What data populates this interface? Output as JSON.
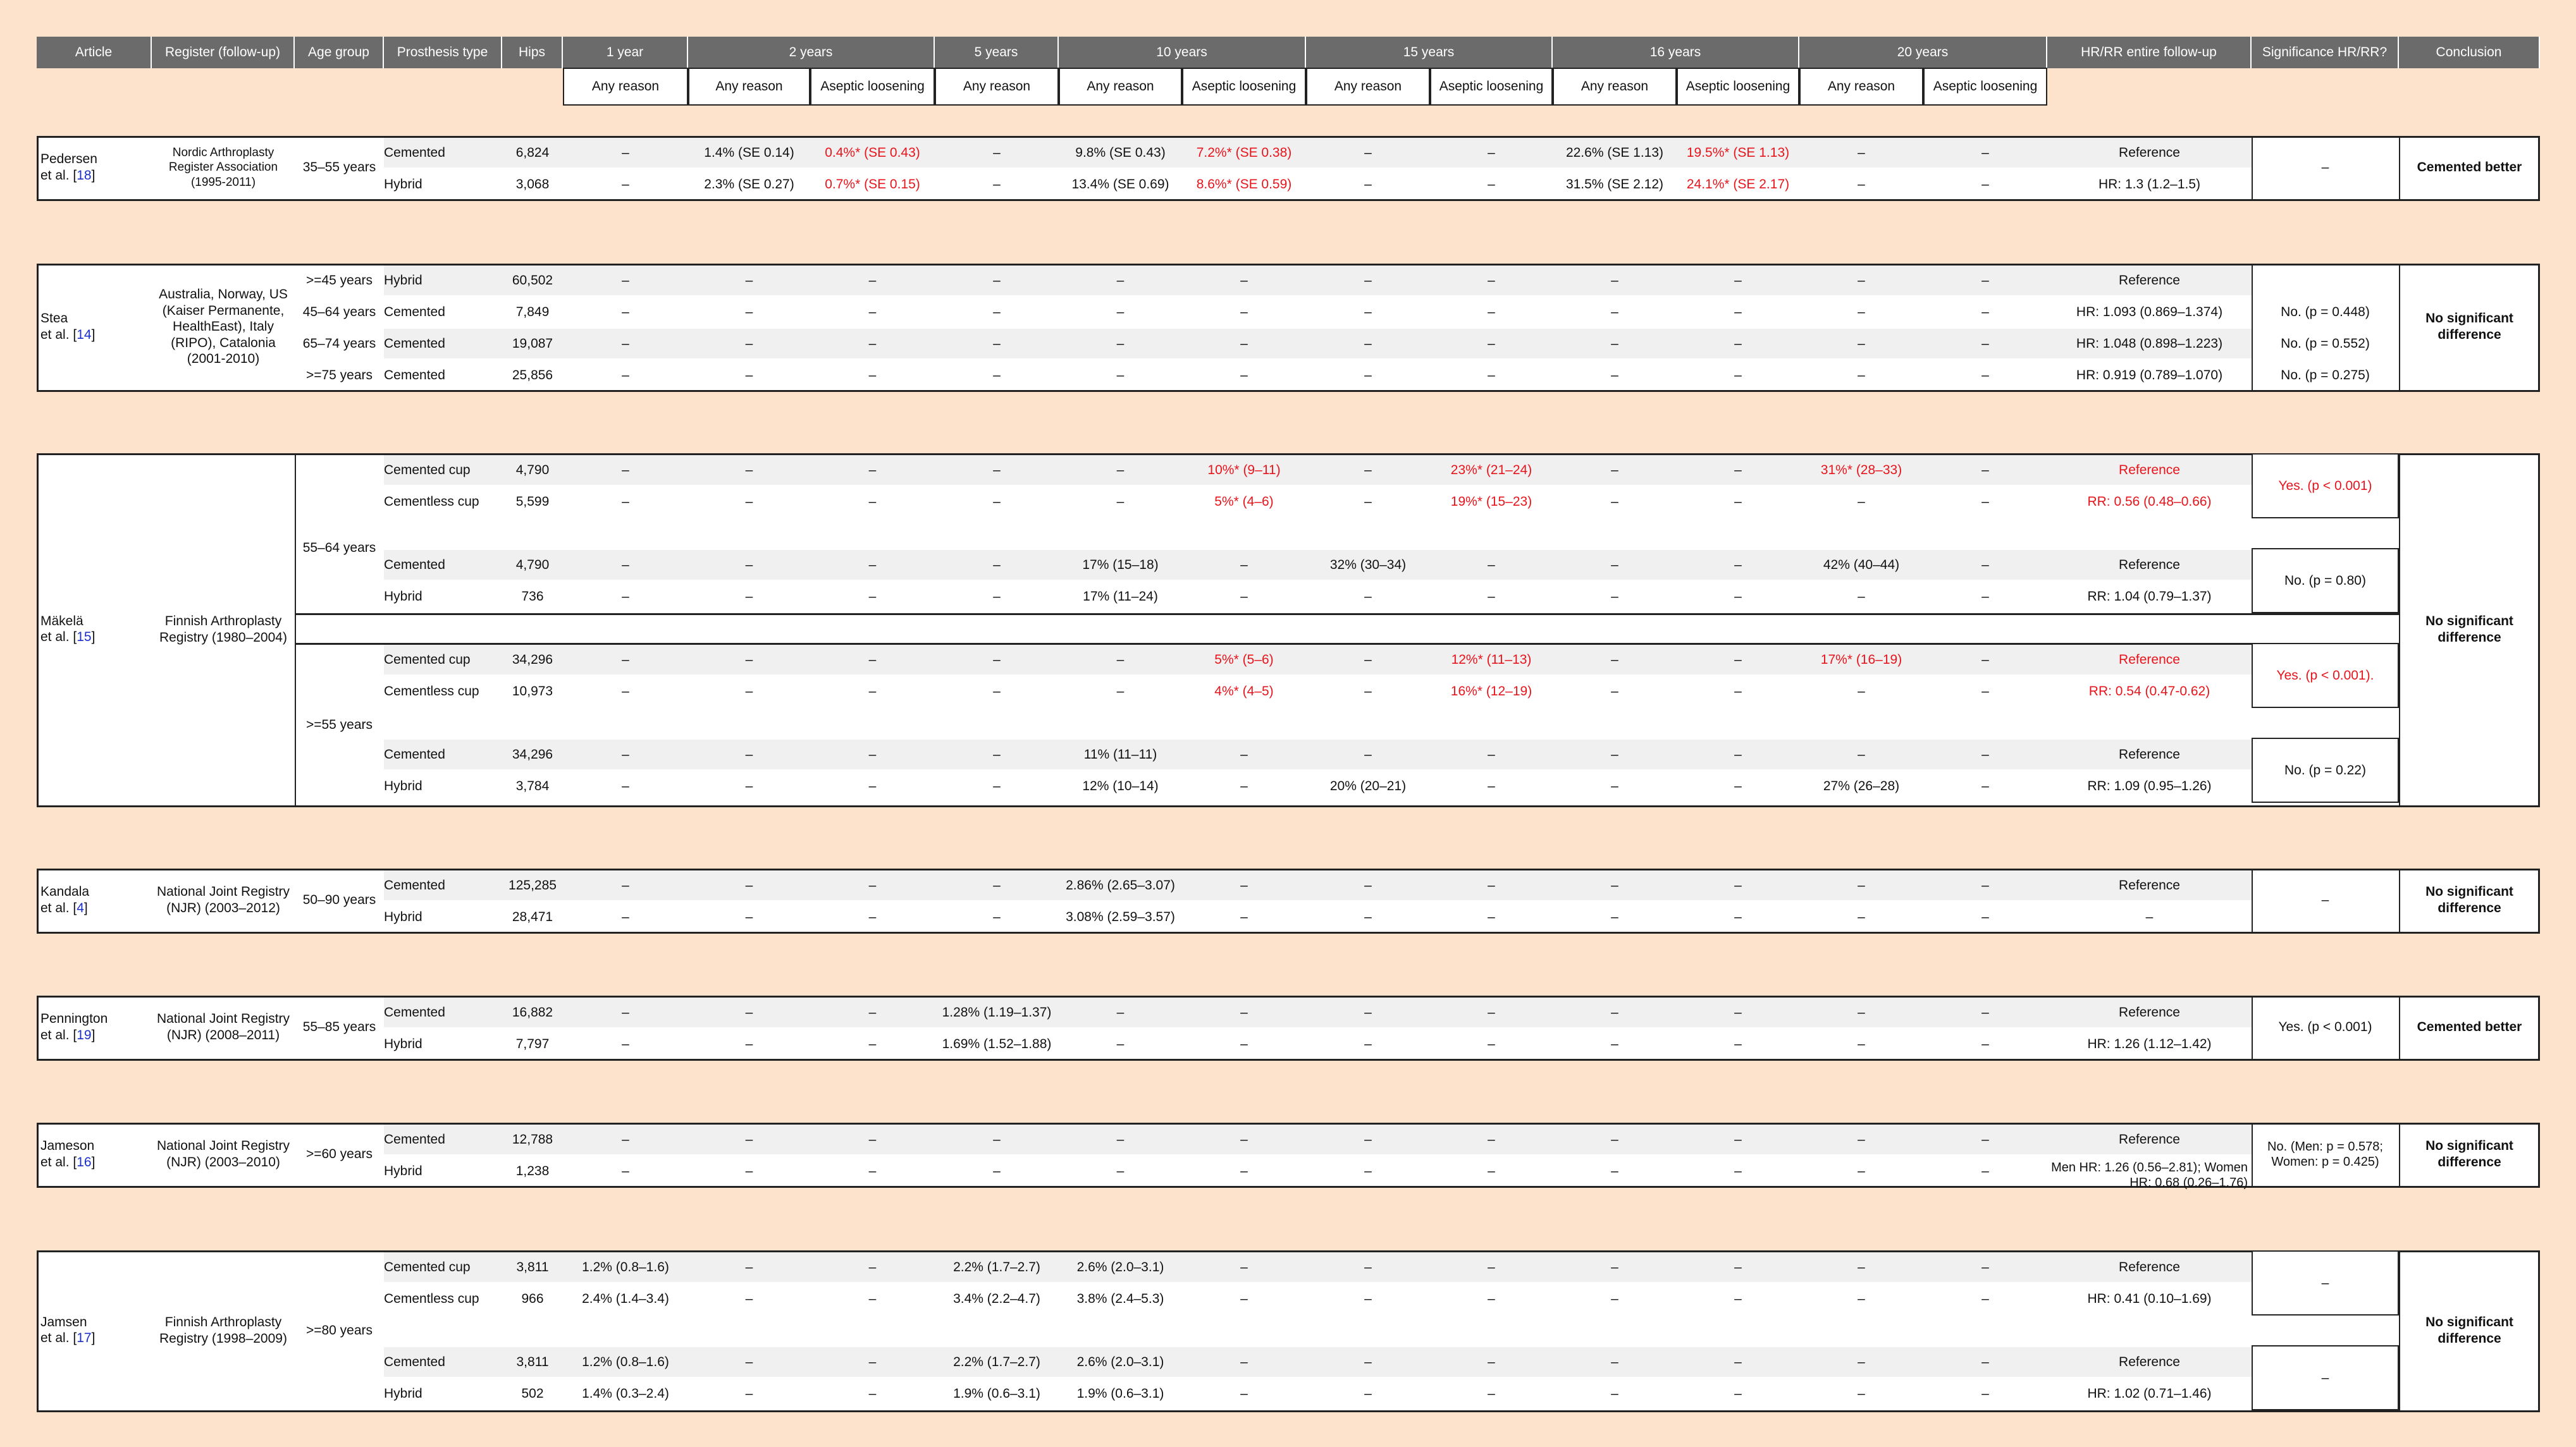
{
  "headers": [
    "Article",
    "Register (follow-up)",
    "Age group",
    "Prosthesis type",
    "Hips",
    "1 year",
    "2 years",
    "5 years",
    "10 years",
    "15 years",
    "16 years",
    "20 years",
    "HR/RR entire follow-up",
    "Significance HR/RR?",
    "Conclusion"
  ],
  "sub_headers": {
    "any": "Any reason",
    "aseptic": "Aseptic loosening"
  },
  "dash": "–",
  "pedersen": {
    "article_a": "Pedersen",
    "article_b": "et al. [",
    "ref": "18",
    "article_c": "]",
    "register": "Nordic Arthroplasty Register Association (1995-2011)",
    "age": "35–55 years",
    "rows": [
      {
        "type": "Cemented",
        "hips": "6,824",
        "y2a": "1.4% (SE 0.14)",
        "y2b": "0.4%* (SE 0.43)",
        "y10a": "9.8% (SE 0.43)",
        "y10b": "7.2%* (SE 0.38)",
        "y16a": "22.6% (SE 1.13)",
        "y16b": "19.5%* (SE 1.13)",
        "hr": "Reference"
      },
      {
        "type": "Hybrid",
        "hips": "3,068",
        "y2a": "2.3% (SE 0.27)",
        "y2b": "0.7%* (SE 0.15)",
        "y10a": "13.4% (SE 0.69)",
        "y10b": "8.6%* (SE 0.59)",
        "y16a": "31.5% (SE 2.12)",
        "y16b": "24.1%* (SE 2.17)",
        "hr": "HR: 1.3 (1.2–1.5)"
      }
    ],
    "sig": "–",
    "conclusion": "Cemented better"
  },
  "stea": {
    "article_a": "Stea",
    "article_b": "et al. [",
    "ref": "14",
    "article_c": "]",
    "register": "Australia, Norway, US (Kaiser Permanente, HealthEast), Italy (RIPO), Catalonia (2001-2010)",
    "rows": [
      {
        "age": ">=45 years",
        "type": "Hybrid",
        "hips": "60,502",
        "hr": "Reference",
        "sig": ""
      },
      {
        "age": "45–64 years",
        "type": "Cemented",
        "hips": "7,849",
        "hr": "HR: 1.093 (0.869–1.374)",
        "sig": "No. (p = 0.448)"
      },
      {
        "age": "65–74 years",
        "type": "Cemented",
        "hips": "19,087",
        "hr": "HR: 1.048 (0.898–1.223)",
        "sig": "No. (p = 0.552)"
      },
      {
        "age": ">=75 years",
        "type": "Cemented",
        "hips": "25,856",
        "hr": "HR: 0.919 (0.789–1.070)",
        "sig": "No. (p = 0.275)"
      }
    ],
    "conclusion": "No significant difference"
  },
  "makela": {
    "article_a": "Mäkelä",
    "article_b": "et al. [",
    "ref": "15",
    "article_c": "]",
    "register": "Finnish Arthroplasty Registry (1980–2004)",
    "age1": "55–64 years",
    "age2": ">=55 years",
    "g1": [
      {
        "type": "Cemented cup",
        "hips": "4,790",
        "y10b": "10%* (9–11)",
        "y15b": "23%* (21–24)",
        "y20a": "31%* (28–33)",
        "hr": "Reference"
      },
      {
        "type": "Cementless cup",
        "hips": "5,599",
        "y10b": "5%* (4–6)",
        "y15b": "19%* (15–23)",
        "y20a": "–",
        "hr": "RR: 0.56 (0.48–0.66)"
      }
    ],
    "g1sig": "Yes. (p < 0.001)",
    "g2": [
      {
        "type": "Cemented",
        "hips": "4,790",
        "y10a": "17% (15–18)",
        "y15a": "32% (30–34)",
        "y20a": "42% (40–44)",
        "hr": "Reference"
      },
      {
        "type": "Hybrid",
        "hips": "736",
        "y10a": "17% (11–24)",
        "y15a": "–",
        "y20a": "–",
        "hr": "RR: 1.04 (0.79–1.37)"
      }
    ],
    "g2sig": "No. (p = 0.80)",
    "g3": [
      {
        "type": "Cemented cup",
        "hips": "34,296",
        "y10b": "5%* (5–6)",
        "y15b": "12%* (11–13)",
        "y20a": "17%* (16–19)",
        "hr": "Reference"
      },
      {
        "type": "Cementless cup",
        "hips": "10,973",
        "y10b": "4%* (4–5)",
        "y15b": "16%* (12–19)",
        "y20a": "–",
        "hr": "RR: 0.54 (0.47-0.62)"
      }
    ],
    "g3sig": "Yes. (p < 0.001).",
    "g4": [
      {
        "type": "Cemented",
        "hips": "34,296",
        "y10a": "11% (11–11)",
        "y15a": "–",
        "y20a": "–",
        "hr": "Reference"
      },
      {
        "type": "Hybrid",
        "hips": "3,784",
        "y10a": "12% (10–14)",
        "y15a": "20% (20–21)",
        "y20a": "27% (26–28)",
        "hr": "RR: 1.09 (0.95–1.26)"
      }
    ],
    "g4sig": "No. (p = 0.22)",
    "conclusion": "No significant difference"
  },
  "kandala": {
    "article_a": "Kandala",
    "article_b": "et al. [",
    "ref": "4",
    "article_c": "]",
    "register": "National Joint Registry (NJR) (2003–2012)",
    "age": "50–90 years",
    "rows": [
      {
        "type": "Cemented",
        "hips": "125,285",
        "y10a": "2.86% (2.65–3.07)",
        "hr": "Reference"
      },
      {
        "type": "Hybrid",
        "hips": "28,471",
        "y10a": "3.08% (2.59–3.57)",
        "hr": "–"
      }
    ],
    "sig": "–",
    "conclusion": "No significant difference"
  },
  "pennington": {
    "article_a": "Pennington",
    "article_b": "et al. [",
    "ref": "19",
    "article_c": "]",
    "register": "National Joint Registry (NJR) (2008–2011)",
    "age": "55–85 years",
    "rows": [
      {
        "type": "Cemented",
        "hips": "16,882",
        "y5a": "1.28% (1.19–1.37)",
        "hr": "Reference"
      },
      {
        "type": "Hybrid",
        "hips": "7,797",
        "y5a": "1.69% (1.52–1.88)",
        "hr": "HR: 1.26 (1.12–1.42)"
      }
    ],
    "sig": "Yes. (p < 0.001)",
    "conclusion": "Cemented better"
  },
  "jameson": {
    "article_a": "Jameson",
    "article_b": "et al. [",
    "ref": "16",
    "article_c": "]",
    "register": "National Joint Registry (NJR) (2003–2010)",
    "age": ">=60 years",
    "rows": [
      {
        "type": "Cemented",
        "hips": "12,788",
        "hr": "Reference"
      },
      {
        "type": "Hybrid",
        "hips": "1,238",
        "hr": "Men HR: 1.26 (0.56–2.81); Women HR: 0.68 (0.26–1.76)"
      }
    ],
    "sig": "No. (Men: p = 0.578; Women: p = 0.425)",
    "conclusion": "No significant difference"
  },
  "jamsen": {
    "article_a": "Jamsen",
    "article_b": "et al. [",
    "ref": "17",
    "article_c": "]",
    "register": "Finnish Arthroplasty Registry (1998–2009)",
    "age": ">=80 years",
    "rows": [
      {
        "type": "Cemented cup",
        "hips": "3,811",
        "y1": "1.2% (0.8–1.6)",
        "y5a": "2.2% (1.7–2.7)",
        "y10a": "2.6% (2.0–3.1)",
        "hr": "Reference"
      },
      {
        "type": "Cementless cup",
        "hips": "966",
        "y1": "2.4% (1.4–3.4)",
        "y5a": "3.4% (2.2–4.7)",
        "y10a": "3.8% (2.4–5.3)",
        "hr": "HR: 0.41 (0.10–1.69)"
      },
      {
        "type": "Cemented",
        "hips": "3,811",
        "y1": "1.2% (0.8–1.6)",
        "y5a": "2.2% (1.7–2.7)",
        "y10a": "2.6% (2.0–3.1)",
        "hr": "Reference"
      },
      {
        "type": "Hybrid",
        "hips": "502",
        "y1": "1.4% (0.3–2.4)",
        "y5a": "1.9% (0.6–3.1)",
        "y10a": "1.9% (0.6–3.1)",
        "hr": "HR: 1.02 (0.71–1.46)"
      }
    ],
    "sig1": "–",
    "sig2": "–",
    "conclusion": "No significant difference"
  }
}
